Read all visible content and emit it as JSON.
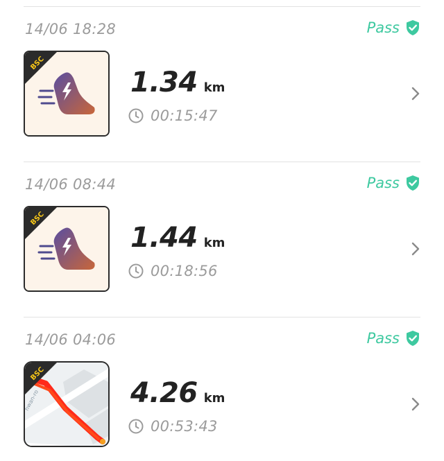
{
  "activities": [
    {
      "timestamp": "14/06 18:28",
      "status": "Pass",
      "badge": "BSC",
      "thumbnail": "running-shoe-icon",
      "distance": "1.34",
      "unit": "km",
      "duration": "00:15:47"
    },
    {
      "timestamp": "14/06 08:44",
      "status": "Pass",
      "badge": "BSC",
      "thumbnail": "running-shoe-icon",
      "distance": "1.44",
      "unit": "km",
      "duration": "00:18:56"
    },
    {
      "timestamp": "14/06 04:06",
      "status": "Pass",
      "badge": "BSC",
      "thumbnail": "route-map",
      "distance": "4.26",
      "unit": "km",
      "duration": "00:53:43",
      "map_labels": [
        "hwan-ro"
      ]
    }
  ],
  "colors": {
    "pass": "#3ec9a0",
    "muted_text": "#9b9b9b",
    "primary_text": "#222222",
    "route": "#ff2a1a",
    "shoe_gradient": [
      "#5a4ea0",
      "#c8663a"
    ]
  }
}
